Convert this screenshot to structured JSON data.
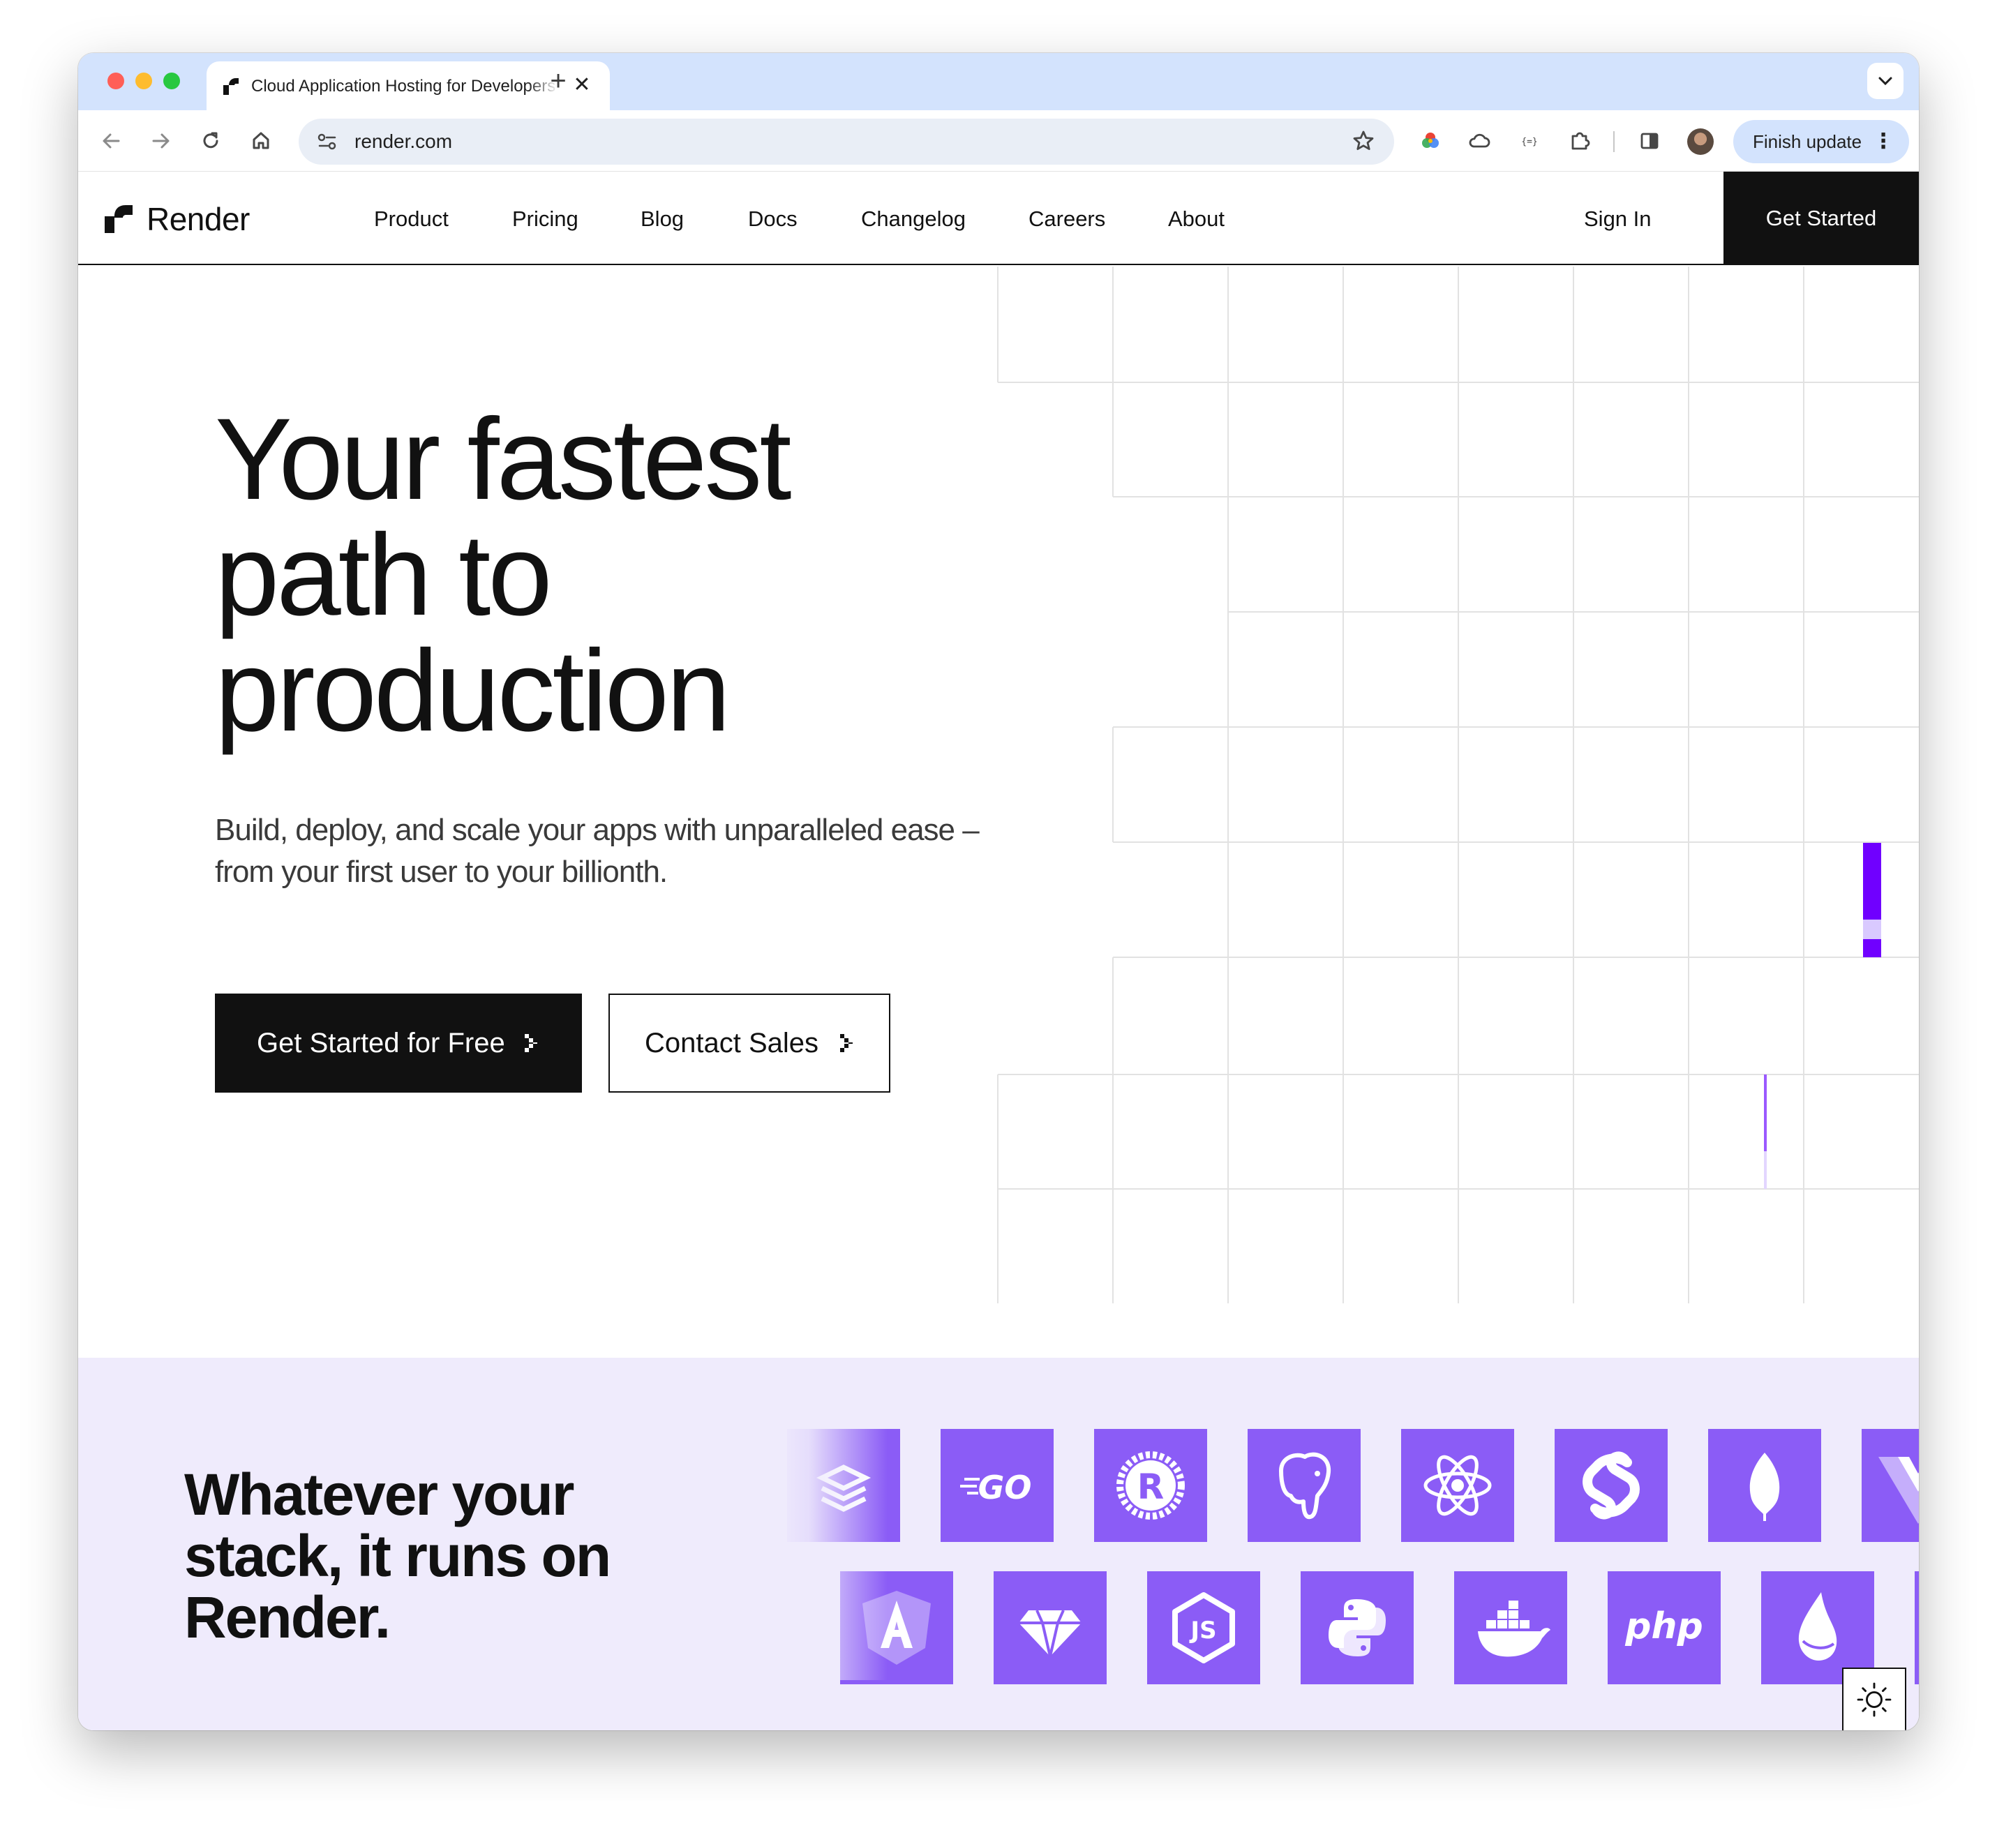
{
  "browser": {
    "tab_title": "Cloud Application Hosting for Developers",
    "url": "render.com",
    "finish_update_label": "Finish update",
    "new_tab_glyph": "+",
    "close_glyph": "✕",
    "tab_search_glyph": "⌄",
    "toolbar_icons": [
      "back-icon",
      "forward-icon",
      "reload-icon",
      "home-icon",
      "site-settings-icon",
      "bookmark-star-icon",
      "color-picker-extension-icon",
      "cloud-extension-icon",
      "json-extension-icon",
      "extensions-puzzle-icon",
      "side-panel-icon",
      "profile-avatar"
    ]
  },
  "nav": {
    "brand": "Render",
    "links": [
      "Product",
      "Pricing",
      "Blog",
      "Docs",
      "Changelog",
      "Careers",
      "About"
    ],
    "sign_in": "Sign In",
    "cta": "Get Started"
  },
  "hero": {
    "title_lines": [
      "Your fastest",
      "path to",
      "production"
    ],
    "subtitle_lines": [
      "Build, deploy, and scale your apps with unparalleled ease –",
      "from your first user to your billionth."
    ],
    "primary_button": "Get Started for Free",
    "secondary_button": "Contact Sales"
  },
  "stack": {
    "title_lines": [
      "Whatever your",
      "stack, it runs on",
      "Render."
    ],
    "row1_logos": [
      "stack-layers-icon",
      "go-logo",
      "rust-logo",
      "postgresql-logo",
      "react-logo",
      "svelte-logo",
      "mongodb-logo",
      "vue-logo"
    ],
    "row2_logos": [
      "angular-logo",
      "ruby-logo",
      "nodejs-logo",
      "python-logo",
      "docker-logo",
      "php-logo",
      "elixir-logo"
    ],
    "go_text": "GO",
    "php_text": "php",
    "js_text": "JS",
    "rust_text": "R"
  },
  "colors": {
    "accent_purple": "#8b5cf6",
    "highlight_purple": "#7000ff",
    "stack_band": "#efebfc",
    "ink": "#111111"
  },
  "theme_toggle_icon": "sun-icon"
}
